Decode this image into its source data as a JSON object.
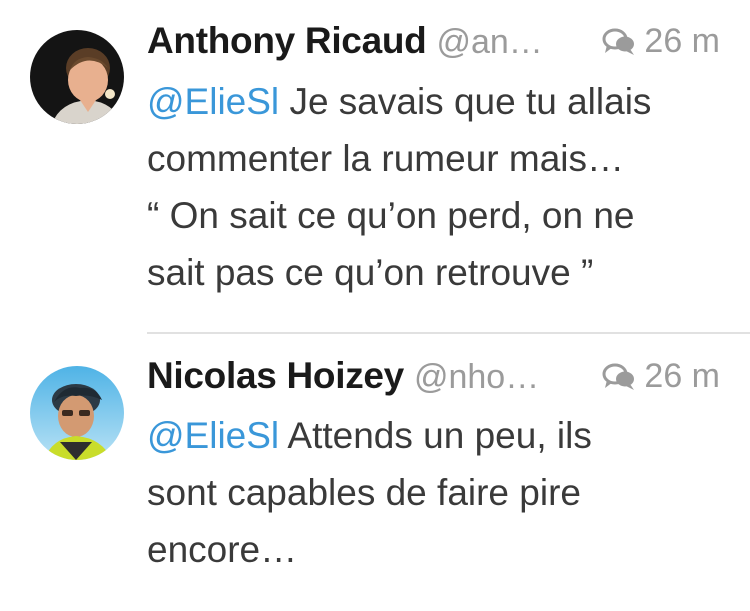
{
  "tweets": [
    {
      "name": "Anthony Ricaud",
      "handle": "@an…",
      "time": "26 m",
      "mention": "@ElieSl",
      "text_lines": [
        "Je savais que tu allais",
        "commenter la rumeur mais…",
        "“ On sait ce qu’on perd, on ne",
        "sait pas ce qu’on retrouve ”"
      ],
      "icon": "conversation-icon"
    },
    {
      "name": "Nicolas Hoizey",
      "handle": "@nho…",
      "time": "26 m",
      "mention": "@ElieSl",
      "text_lines": [
        "Attends un peu, ils",
        "sont capables de faire pire",
        "encore…"
      ],
      "icon": "conversation-icon"
    }
  ],
  "colors": {
    "mention": "#3a97d9",
    "meta": "#9b9b9b",
    "divider": "#e1e1e1"
  }
}
